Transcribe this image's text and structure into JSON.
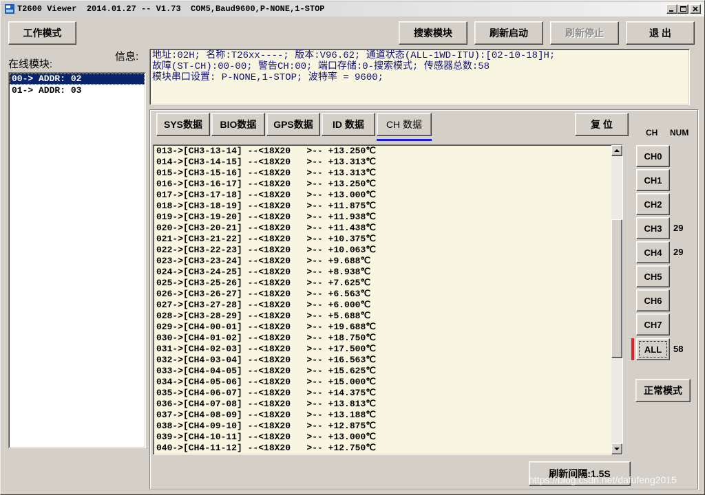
{
  "window": {
    "title": "T2600 Viewer  2014.01.27 -- V1.73  COM5,Baud9600,P-NONE,1-STOP"
  },
  "toolbar": {
    "work_mode": {
      "label": "工作模式",
      "enabled": true
    },
    "search": {
      "label": "搜索模块",
      "enabled": true
    },
    "refresh_start": {
      "label": "刷新启动",
      "enabled": true
    },
    "refresh_stop": {
      "label": "刷新停止",
      "enabled": false
    },
    "exit": {
      "label": "退 出",
      "enabled": true
    }
  },
  "modules": {
    "label": "在线模块:",
    "items": [
      {
        "text": "00-> ADDR: 02",
        "selected": true
      },
      {
        "text": "01-> ADDR: 03",
        "selected": false
      }
    ]
  },
  "info": {
    "label": "信息:",
    "lines": [
      "地址:02H; 名称:T26xx----; 版本:V96.62; 通道状态(ALL-1WD-ITU):[02-10-18]H;",
      "故障(ST-CH):00-00; 警告CH:00; 端口存储:0-搜索模式; 传感器总数:58",
      "模块串口设置: P-NONE,1-STOP; 波特率 = 9600;"
    ]
  },
  "tabs": [
    {
      "label": "SYS数据",
      "selected": false
    },
    {
      "label": "BIO数据",
      "selected": false
    },
    {
      "label": "GPS数据",
      "selected": false
    },
    {
      "label": "ID 数据",
      "selected": false
    },
    {
      "label": "CH 数据",
      "selected": true
    }
  ],
  "reset_button": "复 位",
  "channels": {
    "header_ch": "CH",
    "header_num": "NUM",
    "selected": "ALL",
    "items": [
      {
        "label": "CH0"
      },
      {
        "label": "CH1"
      },
      {
        "label": "CH2"
      },
      {
        "label": "CH3",
        "num": "29"
      },
      {
        "label": "CH4",
        "num": "29"
      },
      {
        "label": "CH5"
      },
      {
        "label": "CH6"
      },
      {
        "label": "CH7"
      },
      {
        "label": "ALL",
        "num": "58"
      }
    ]
  },
  "normal_mode_button": "正常模式",
  "data_rows": [
    "013->[CH3-13-14] --<18X20   >-- +13.250℃",
    "014->[CH3-14-15] --<18X20   >-- +13.313℃",
    "015->[CH3-15-16] --<18X20   >-- +13.313℃",
    "016->[CH3-16-17] --<18X20   >-- +13.250℃",
    "017->[CH3-17-18] --<18X20   >-- +13.000℃",
    "018->[CH3-18-19] --<18X20   >-- +11.875℃",
    "019->[CH3-19-20] --<18X20   >-- +11.938℃",
    "020->[CH3-20-21] --<18X20   >-- +11.438℃",
    "021->[CH3-21-22] --<18X20   >-- +10.375℃",
    "022->[CH3-22-23] --<18X20   >-- +10.063℃",
    "023->[CH3-23-24] --<18X20   >-- +9.688℃",
    "024->[CH3-24-25] --<18X20   >-- +8.938℃",
    "025->[CH3-25-26] --<18X20   >-- +7.625℃",
    "026->[CH3-26-27] --<18X20   >-- +6.563℃",
    "027->[CH3-27-28] --<18X20   >-- +6.000℃",
    "028->[CH3-28-29] --<18X20   >-- +5.688℃",
    "029->[CH4-00-01] --<18X20   >-- +19.688℃",
    "030->[CH4-01-02] --<18X20   >-- +18.750℃",
    "031->[CH4-02-03] --<18X20   >-- +17.500℃",
    "032->[CH4-03-04] --<18X20   >-- +16.563℃",
    "033->[CH4-04-05] --<18X20   >-- +15.625℃",
    "034->[CH4-05-06] --<18X20   >-- +15.000℃",
    "035->[CH4-06-07] --<18X20   >-- +14.375℃",
    "036->[CH4-07-08] --<18X20   >-- +13.813℃",
    "037->[CH4-08-09] --<18X20   >-- +13.188℃",
    "038->[CH4-09-10] --<18X20   >-- +12.875℃",
    "039->[CH4-10-11] --<18X20   >-- +13.000℃",
    "040->[CH4-11-12] --<18X20   >-- +12.750℃"
  ],
  "refresh_interval_button": "刷新间隔:1.5S",
  "watermark": "https://blog.csdn.net/dafufeng2015",
  "icons": {
    "app": "app-icon",
    "minimize": "minimize-icon",
    "maximize": "maximize-icon",
    "close": "close-icon",
    "scroll_up": "scroll-up-icon",
    "scroll_down": "scroll-down-icon"
  },
  "colors": {
    "window_bg": "#d4d0c8",
    "panel_bg": "#f8f5e1",
    "selection_bg": "#0a246a",
    "info_text": "#10107a",
    "indicator": "#e0202a",
    "tab_underline": "#1c1ce0"
  }
}
